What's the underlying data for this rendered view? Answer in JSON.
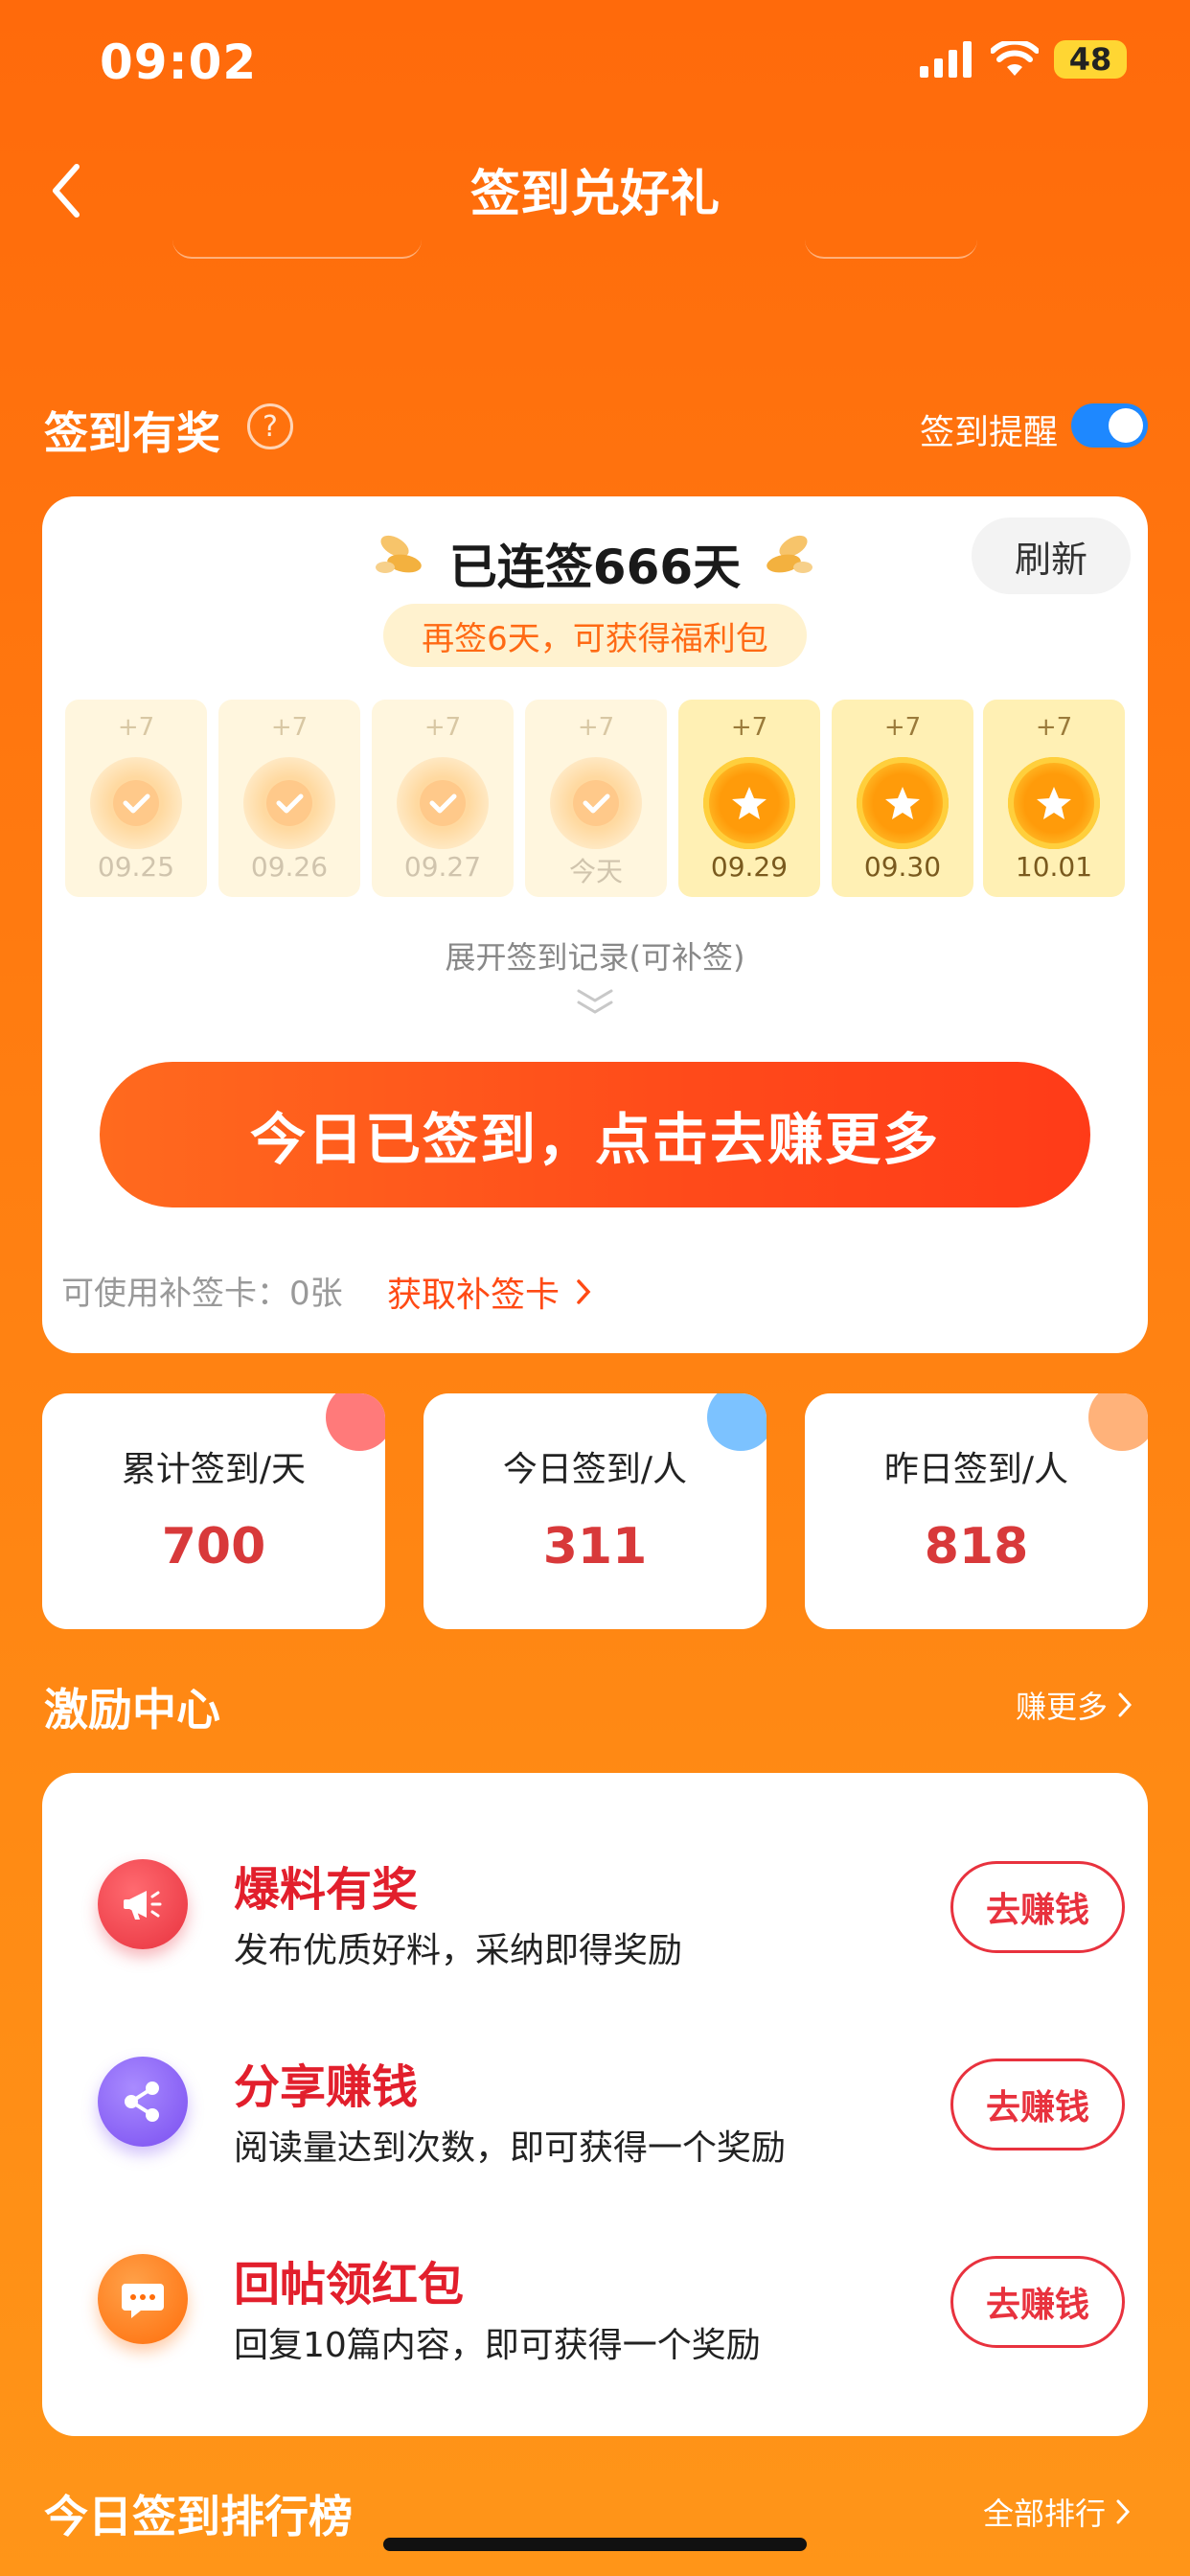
{
  "status_bar": {
    "time": "09:02",
    "battery": "48"
  },
  "nav": {
    "title": "签到兑好礼"
  },
  "checkin": {
    "section_title": "签到有奖",
    "remind_label": "签到提醒",
    "remind_on": true,
    "streak_text": "已连签666天",
    "refresh_label": "刷新",
    "bonus_text": "再签6天，可获得福利包",
    "days": [
      {
        "plus": "+7",
        "date": "09.25",
        "state": "checked"
      },
      {
        "plus": "+7",
        "date": "09.26",
        "state": "checked"
      },
      {
        "plus": "+7",
        "date": "09.27",
        "state": "checked"
      },
      {
        "plus": "+7",
        "date": "今天",
        "state": "checked"
      },
      {
        "plus": "+7",
        "date": "09.29",
        "state": "upcoming"
      },
      {
        "plus": "+7",
        "date": "09.30",
        "state": "upcoming"
      },
      {
        "plus": "+7",
        "date": "10.01",
        "state": "upcoming"
      }
    ],
    "expand_text": "展开签到记录(可补签)",
    "main_button": "今日已签到，点击去赚更多",
    "makeup_label": "可使用补签卡：0张",
    "makeup_link": "获取补签卡"
  },
  "stats": [
    {
      "label": "累计签到/天",
      "value": "700",
      "dot_color": "#ff7a7a"
    },
    {
      "label": "今日签到/人",
      "value": "311",
      "dot_color": "#7cc2ff"
    },
    {
      "label": "昨日签到/人",
      "value": "818",
      "dot_color": "#ffb27a"
    }
  ],
  "incentive": {
    "section_title": "激励中心",
    "more_label": "赚更多",
    "tasks": [
      {
        "title": "爆料有奖",
        "desc": "发布优质好料，采纳即得奖励",
        "button": "去赚钱",
        "icon": "megaphone-icon",
        "color": "#f0404a"
      },
      {
        "title": "分享赚钱",
        "desc": "阅读量达到次数，即可获得一个奖励",
        "button": "去赚钱",
        "icon": "share-icon",
        "color": "#8a5cf6"
      },
      {
        "title": "回帖领红包",
        "desc": "回复10篇内容，即可获得一个奖励",
        "button": "去赚钱",
        "icon": "comment-icon",
        "color": "#ff7a14"
      }
    ]
  },
  "ranking": {
    "section_title": "今日签到排行榜",
    "more_label": "全部排行"
  }
}
